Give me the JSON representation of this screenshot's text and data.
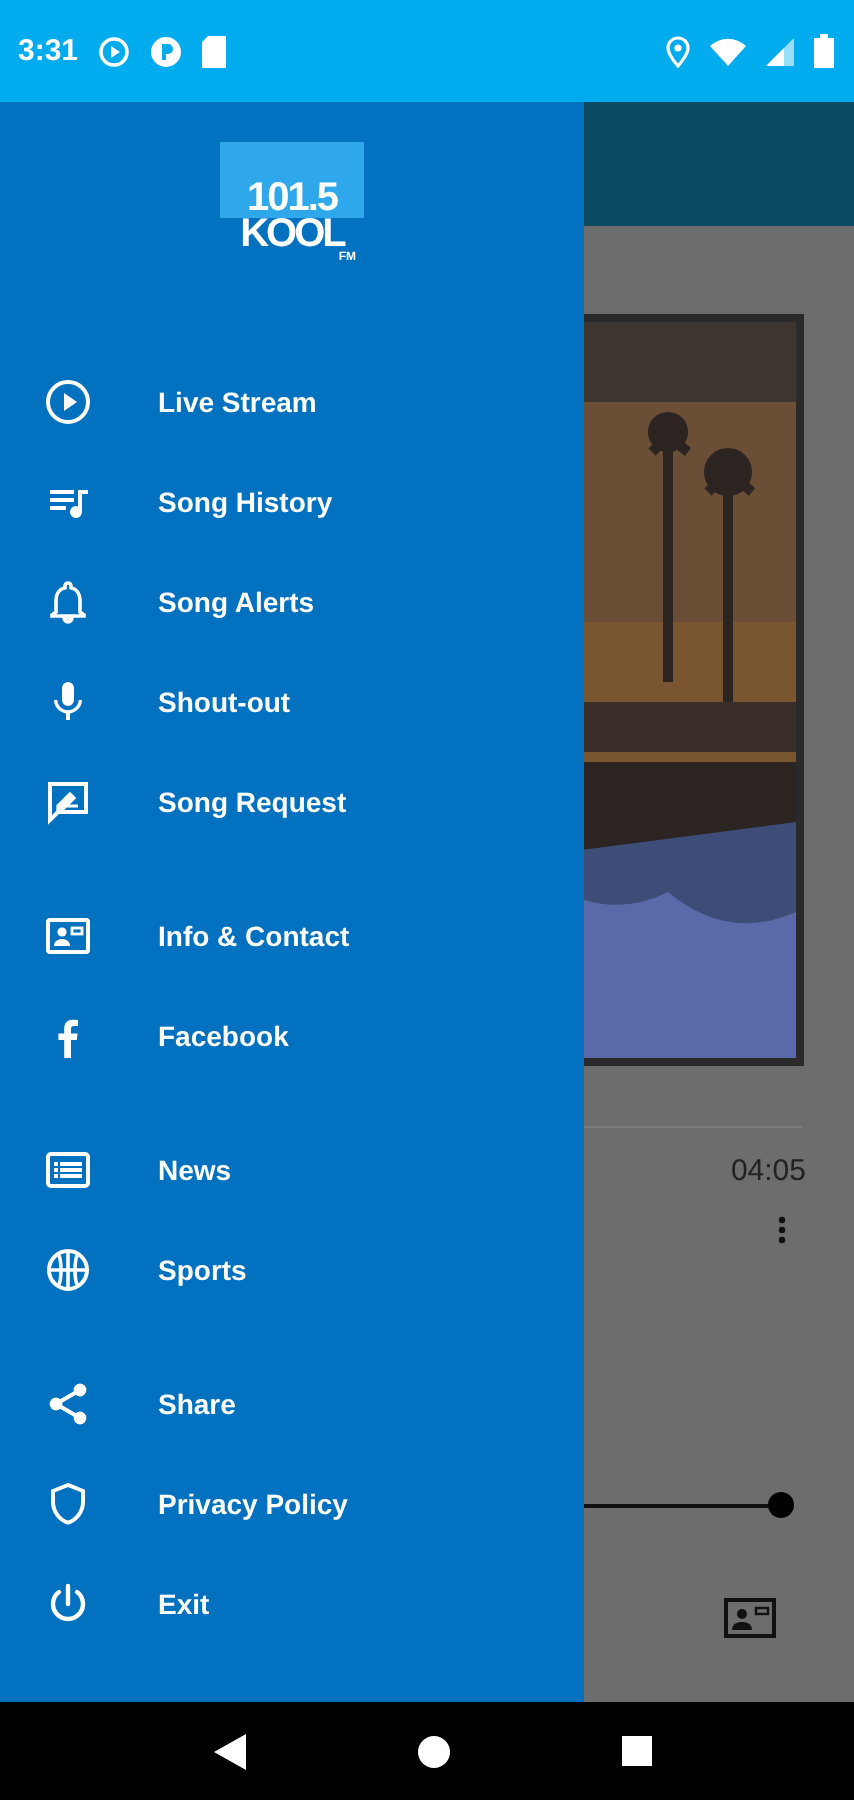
{
  "status_bar": {
    "time": "3:31"
  },
  "drawer": {
    "logo": {
      "frequency": "101.5",
      "name": "KOOL",
      "band": "FM"
    },
    "groups": [
      {
        "items": [
          {
            "label": "Live Stream"
          },
          {
            "label": "Song History"
          },
          {
            "label": "Song Alerts"
          },
          {
            "label": "Shout-out"
          },
          {
            "label": "Song Request"
          }
        ]
      },
      {
        "items": [
          {
            "label": "Info & Contact"
          },
          {
            "label": "Facebook"
          }
        ]
      },
      {
        "items": [
          {
            "label": "News"
          },
          {
            "label": "Sports"
          }
        ]
      },
      {
        "items": [
          {
            "label": "Share"
          },
          {
            "label": "Privacy Policy"
          },
          {
            "label": "Exit"
          }
        ]
      }
    ]
  },
  "player": {
    "duration": "04:05",
    "progress": {
      "level": 1
    }
  }
}
